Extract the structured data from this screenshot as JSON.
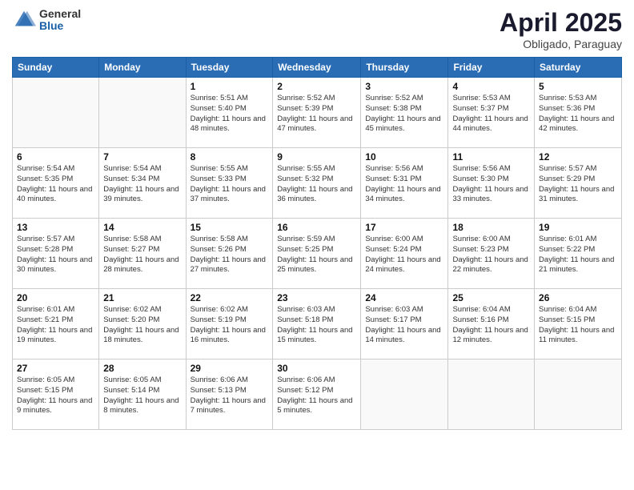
{
  "logo": {
    "general": "General",
    "blue": "Blue"
  },
  "title": {
    "month": "April 2025",
    "location": "Obligado, Paraguay"
  },
  "weekdays": [
    "Sunday",
    "Monday",
    "Tuesday",
    "Wednesday",
    "Thursday",
    "Friday",
    "Saturday"
  ],
  "weeks": [
    [
      {
        "day": "",
        "info": ""
      },
      {
        "day": "",
        "info": ""
      },
      {
        "day": "1",
        "info": "Sunrise: 5:51 AM\nSunset: 5:40 PM\nDaylight: 11 hours and 48 minutes."
      },
      {
        "day": "2",
        "info": "Sunrise: 5:52 AM\nSunset: 5:39 PM\nDaylight: 11 hours and 47 minutes."
      },
      {
        "day": "3",
        "info": "Sunrise: 5:52 AM\nSunset: 5:38 PM\nDaylight: 11 hours and 45 minutes."
      },
      {
        "day": "4",
        "info": "Sunrise: 5:53 AM\nSunset: 5:37 PM\nDaylight: 11 hours and 44 minutes."
      },
      {
        "day": "5",
        "info": "Sunrise: 5:53 AM\nSunset: 5:36 PM\nDaylight: 11 hours and 42 minutes."
      }
    ],
    [
      {
        "day": "6",
        "info": "Sunrise: 5:54 AM\nSunset: 5:35 PM\nDaylight: 11 hours and 40 minutes."
      },
      {
        "day": "7",
        "info": "Sunrise: 5:54 AM\nSunset: 5:34 PM\nDaylight: 11 hours and 39 minutes."
      },
      {
        "day": "8",
        "info": "Sunrise: 5:55 AM\nSunset: 5:33 PM\nDaylight: 11 hours and 37 minutes."
      },
      {
        "day": "9",
        "info": "Sunrise: 5:55 AM\nSunset: 5:32 PM\nDaylight: 11 hours and 36 minutes."
      },
      {
        "day": "10",
        "info": "Sunrise: 5:56 AM\nSunset: 5:31 PM\nDaylight: 11 hours and 34 minutes."
      },
      {
        "day": "11",
        "info": "Sunrise: 5:56 AM\nSunset: 5:30 PM\nDaylight: 11 hours and 33 minutes."
      },
      {
        "day": "12",
        "info": "Sunrise: 5:57 AM\nSunset: 5:29 PM\nDaylight: 11 hours and 31 minutes."
      }
    ],
    [
      {
        "day": "13",
        "info": "Sunrise: 5:57 AM\nSunset: 5:28 PM\nDaylight: 11 hours and 30 minutes."
      },
      {
        "day": "14",
        "info": "Sunrise: 5:58 AM\nSunset: 5:27 PM\nDaylight: 11 hours and 28 minutes."
      },
      {
        "day": "15",
        "info": "Sunrise: 5:58 AM\nSunset: 5:26 PM\nDaylight: 11 hours and 27 minutes."
      },
      {
        "day": "16",
        "info": "Sunrise: 5:59 AM\nSunset: 5:25 PM\nDaylight: 11 hours and 25 minutes."
      },
      {
        "day": "17",
        "info": "Sunrise: 6:00 AM\nSunset: 5:24 PM\nDaylight: 11 hours and 24 minutes."
      },
      {
        "day": "18",
        "info": "Sunrise: 6:00 AM\nSunset: 5:23 PM\nDaylight: 11 hours and 22 minutes."
      },
      {
        "day": "19",
        "info": "Sunrise: 6:01 AM\nSunset: 5:22 PM\nDaylight: 11 hours and 21 minutes."
      }
    ],
    [
      {
        "day": "20",
        "info": "Sunrise: 6:01 AM\nSunset: 5:21 PM\nDaylight: 11 hours and 19 minutes."
      },
      {
        "day": "21",
        "info": "Sunrise: 6:02 AM\nSunset: 5:20 PM\nDaylight: 11 hours and 18 minutes."
      },
      {
        "day": "22",
        "info": "Sunrise: 6:02 AM\nSunset: 5:19 PM\nDaylight: 11 hours and 16 minutes."
      },
      {
        "day": "23",
        "info": "Sunrise: 6:03 AM\nSunset: 5:18 PM\nDaylight: 11 hours and 15 minutes."
      },
      {
        "day": "24",
        "info": "Sunrise: 6:03 AM\nSunset: 5:17 PM\nDaylight: 11 hours and 14 minutes."
      },
      {
        "day": "25",
        "info": "Sunrise: 6:04 AM\nSunset: 5:16 PM\nDaylight: 11 hours and 12 minutes."
      },
      {
        "day": "26",
        "info": "Sunrise: 6:04 AM\nSunset: 5:15 PM\nDaylight: 11 hours and 11 minutes."
      }
    ],
    [
      {
        "day": "27",
        "info": "Sunrise: 6:05 AM\nSunset: 5:15 PM\nDaylight: 11 hours and 9 minutes."
      },
      {
        "day": "28",
        "info": "Sunrise: 6:05 AM\nSunset: 5:14 PM\nDaylight: 11 hours and 8 minutes."
      },
      {
        "day": "29",
        "info": "Sunrise: 6:06 AM\nSunset: 5:13 PM\nDaylight: 11 hours and 7 minutes."
      },
      {
        "day": "30",
        "info": "Sunrise: 6:06 AM\nSunset: 5:12 PM\nDaylight: 11 hours and 5 minutes."
      },
      {
        "day": "",
        "info": ""
      },
      {
        "day": "",
        "info": ""
      },
      {
        "day": "",
        "info": ""
      }
    ]
  ]
}
